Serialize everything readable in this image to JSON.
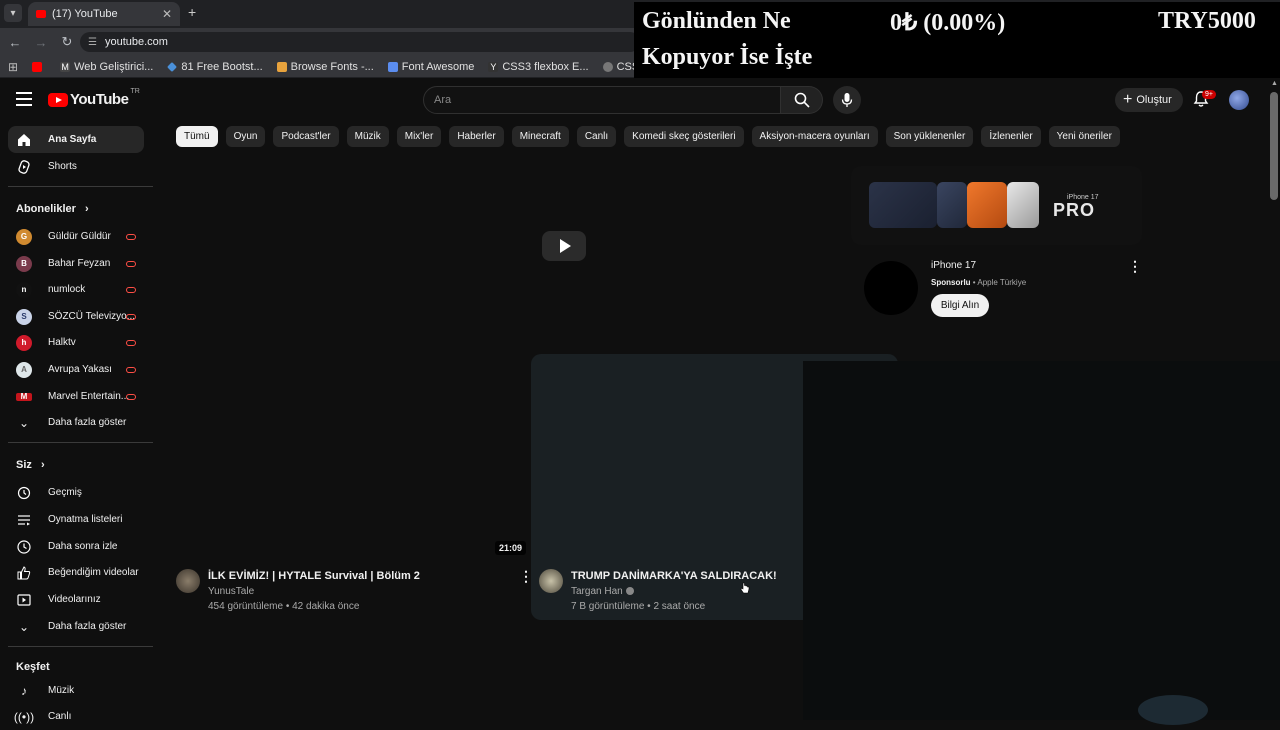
{
  "browser": {
    "tab_title": "(17) YouTube",
    "url": "youtube.com",
    "bookmarks": [
      {
        "label": "",
        "icon": "youtube-icon",
        "color": "#ff0000"
      },
      {
        "label": "Web Geliştirici...",
        "icon": "m-icon",
        "color": "#444"
      },
      {
        "label": "81 Free Bootst...",
        "icon": "diamond-icon",
        "color": "#4a90d9"
      },
      {
        "label": "Browse Fonts -...",
        "icon": "google-fonts-icon",
        "color": "#e8a33d"
      },
      {
        "label": "Font Awesome",
        "icon": "flag-icon",
        "color": "#5b8def"
      },
      {
        "label": "CSS3 flexbox E...",
        "icon": "y-icon",
        "color": "#333"
      },
      {
        "label": "CSS Flex ile i...",
        "icon": "globe-icon",
        "color": "#777"
      }
    ]
  },
  "overlay": {
    "line1_left": "Gönlünden Ne",
    "line1_mid": "0₺ (0.00%)",
    "line1_right": "TRY5000",
    "line2": "Kopuyor İse İşte"
  },
  "header": {
    "logo_text": "YouTube",
    "country": "TR",
    "search_placeholder": "Ara",
    "create_label": "Oluştur",
    "notif_badge": "9+"
  },
  "sidebar": {
    "main": [
      {
        "label": "Ana Sayfa",
        "icon": "home-icon"
      },
      {
        "label": "Shorts",
        "icon": "shorts-icon"
      }
    ],
    "subs_title": "Abonelikler",
    "subs": [
      {
        "label": "Güldür Güldür",
        "color": "#d08a30",
        "initial": "G"
      },
      {
        "label": "Bahar Feyzan",
        "color": "#7a3b4c",
        "initial": "B"
      },
      {
        "label": "numlock",
        "color": "#111",
        "initial": "n"
      },
      {
        "label": "SÖZCÜ Televizyo...",
        "color": "#c9d3e8",
        "initial": "S"
      },
      {
        "label": "Halktv",
        "color": "#d01a2b",
        "initial": "h"
      },
      {
        "label": "Avrupa Yakası",
        "color": "#dfe7ea",
        "initial": "A"
      },
      {
        "label": "Marvel Entertain...",
        "color": "#c4151c",
        "initial": "M"
      }
    ],
    "subs_more": "Daha fazla göster",
    "you_title": "Siz",
    "you": [
      {
        "label": "Geçmiş",
        "icon": "history-icon"
      },
      {
        "label": "Oynatma listeleri",
        "icon": "playlist-icon"
      },
      {
        "label": "Daha sonra izle",
        "icon": "clock-icon"
      },
      {
        "label": "Beğendiğim videolar",
        "icon": "thumbs-up-icon"
      },
      {
        "label": "Videolarınız",
        "icon": "video-icon"
      }
    ],
    "you_more": "Daha fazla göster",
    "explore_title": "Keşfet",
    "explore": [
      {
        "label": "Müzik",
        "icon": "music-icon"
      },
      {
        "label": "Canlı",
        "icon": "live-icon"
      }
    ]
  },
  "chips": [
    "Tümü",
    "Oyun",
    "Podcast'ler",
    "Müzik",
    "Mix'ler",
    "Haberler",
    "Minecraft",
    "Canlı",
    "Komedi skeç gösterileri",
    "Aksiyon-macera oyunları",
    "Son yüklenenler",
    "İzlenenler",
    "Yeni öneriler"
  ],
  "ad": {
    "banner_sub": "iPhone 17",
    "banner_brand": "PRO",
    "title": "iPhone 17",
    "sponsored": "Sponsorlu",
    "advertiser": "Apple Türkiye",
    "cta": "Bilgi Alın"
  },
  "videos": [
    {
      "title": "İLK EVİMİZ! | HYTALE Survival | Bölüm 2",
      "channel": "YunusTale",
      "views": "454 görüntüleme",
      "age": "42 dakika önce",
      "duration": "21:09"
    },
    {
      "title": "TRUMP DANİMARKA'YA SALDIRACAK!",
      "channel": "Targan Han",
      "views": "7 B görüntüleme",
      "age": "2 saat önce"
    }
  ]
}
